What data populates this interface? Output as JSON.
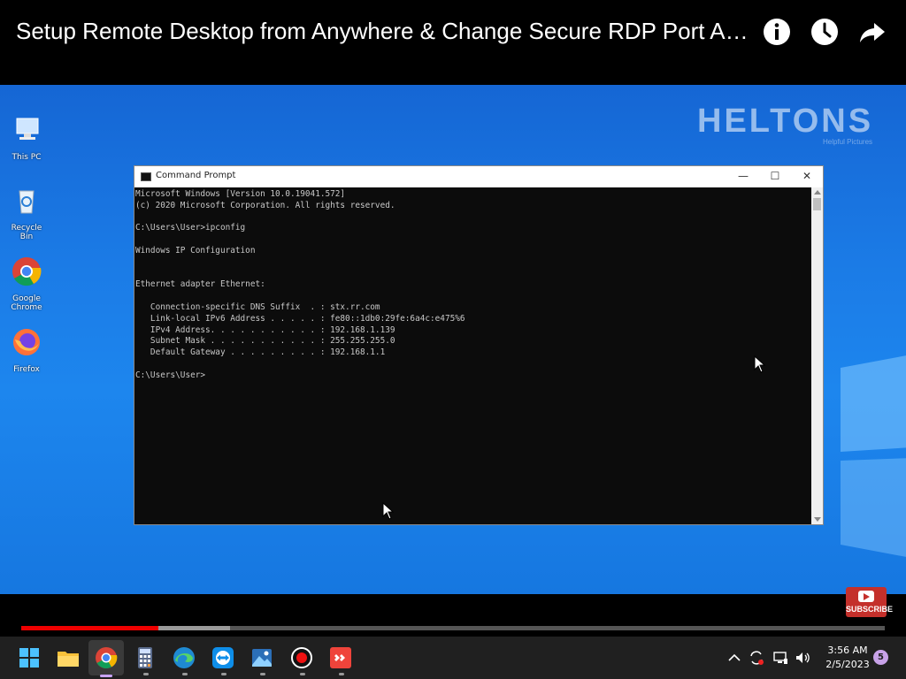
{
  "video": {
    "title": "Setup Remote Desktop from Anywhere & Change Secure RDP Port A…",
    "progress_played": 0.159,
    "progress_buffered": 0.242,
    "subscribe_label": "SUBSCRIBE"
  },
  "header_icons": [
    "info-icon",
    "watch-later-clock-icon",
    "share-arrow-icon"
  ],
  "desktop": {
    "watermark": "HELTONS",
    "watermark_sub": "Helpful Pictures",
    "icons": [
      {
        "label": "This PC",
        "icon": "this-pc-icon"
      },
      {
        "label": "Recycle Bin",
        "icon": "recycle-bin-icon"
      },
      {
        "label": "Google Chrome",
        "icon": "chrome-icon"
      },
      {
        "label": "Firefox",
        "icon": "firefox-icon"
      }
    ]
  },
  "cmd": {
    "title": "Command Prompt",
    "minimize": "—",
    "maximize": "☐",
    "close": "✕",
    "lines": [
      "Microsoft Windows [Version 10.0.19041.572]",
      "(c) 2020 Microsoft Corporation. All rights reserved.",
      "",
      "C:\\Users\\User>ipconfig",
      "",
      "Windows IP Configuration",
      "",
      "",
      "Ethernet adapter Ethernet:",
      "",
      "   Connection-specific DNS Suffix  . : stx.rr.com",
      "   Link-local IPv6 Address . . . . . : fe80::1db0:29fe:6a4c:e475%6",
      "   IPv4 Address. . . . . . . . . . . : 192.168.1.139",
      "   Subnet Mask . . . . . . . . . . . : 255.255.255.0",
      "   Default Gateway . . . . . . . . . : 192.168.1.1",
      "",
      "C:\\Users\\User>"
    ]
  },
  "taskbar": {
    "apps": [
      "start-icon",
      "file-explorer-icon",
      "chrome-icon",
      "calculator-icon",
      "edge-icon",
      "teamviewer-icon",
      "photos-icon",
      "screen-recorder-icon",
      "anydesk-icon"
    ],
    "tray_icons": [
      "chevron-up-icon",
      "sync-icon",
      "network-icon",
      "volume-icon"
    ],
    "time": "3:56 AM",
    "date": "2/5/2023",
    "notification_count": "5"
  },
  "colors": {
    "desktop_blue": "#1b7be6",
    "progress_red": "#e00000",
    "taskbar": "#202020"
  }
}
